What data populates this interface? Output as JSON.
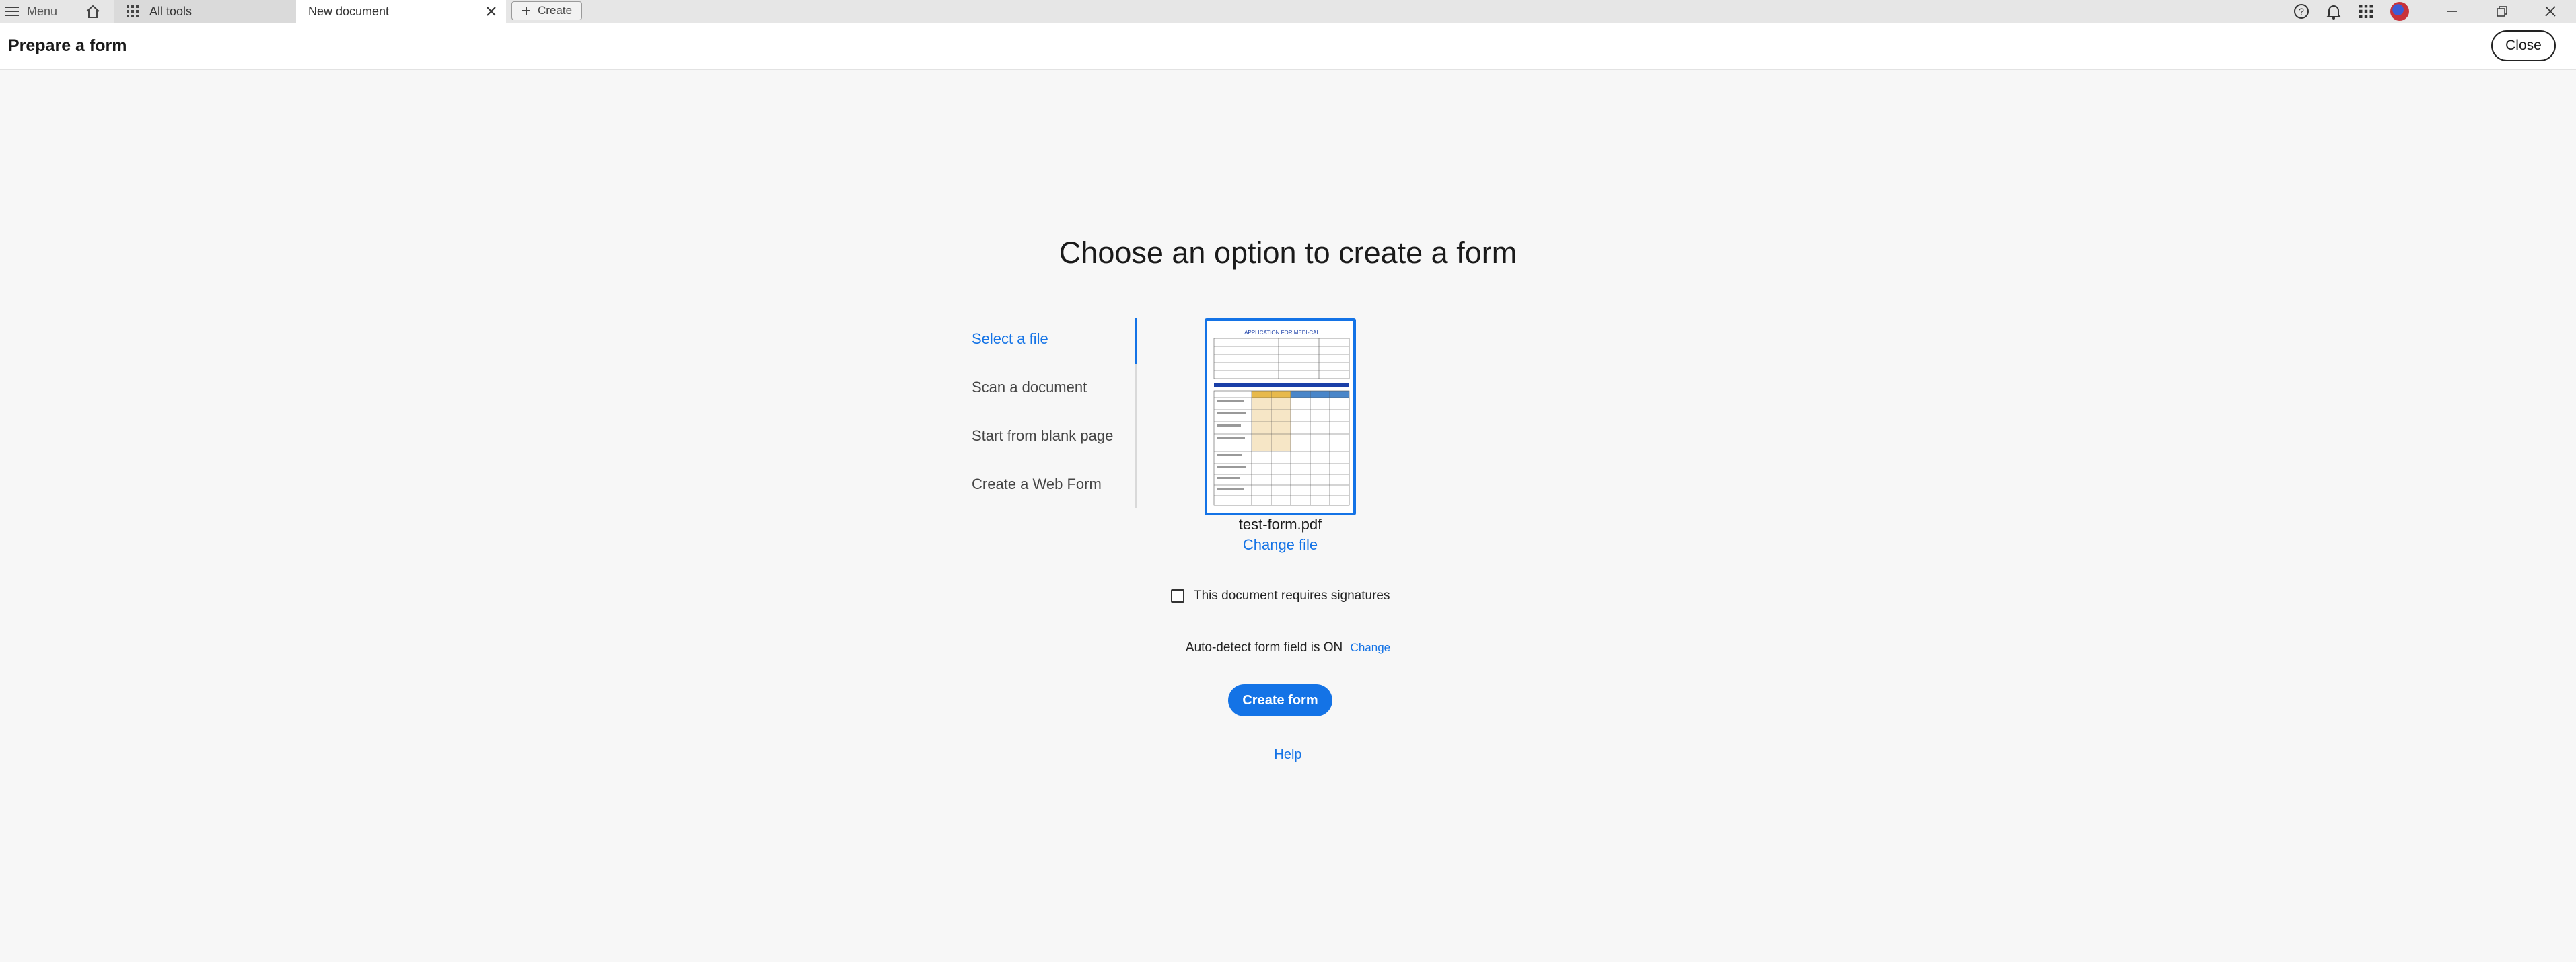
{
  "tabbar": {
    "menu_label": "Menu",
    "tabs": [
      {
        "label": "All tools",
        "icon": "grid-icon"
      },
      {
        "label": "New document",
        "icon": "close-icon"
      }
    ],
    "create_label": "Create",
    "right_icons": [
      "help-icon",
      "bell-icon",
      "apps-icon",
      "avatar",
      "minimize-icon",
      "restore-icon",
      "close-window-icon"
    ]
  },
  "header": {
    "title": "Prepare a form",
    "close_label": "Close"
  },
  "main": {
    "heading": "Choose an option to create a form",
    "options": [
      {
        "label": "Select a file",
        "active": true
      },
      {
        "label": "Scan a document",
        "active": false
      },
      {
        "label": "Start from blank page",
        "active": false
      },
      {
        "label": "Create a Web Form",
        "active": false
      }
    ],
    "thumbnail_title": "APPLICATION FOR MEDI-CAL",
    "file_name": "test-form.pdf",
    "change_file_label": "Change file",
    "signature_label": "This document requires signatures",
    "signature_checked": false,
    "auto_detect_text": "Auto-detect form field is ON",
    "auto_detect_change": "Change",
    "create_form_label": "Create form",
    "help_label": "Help"
  },
  "colors": {
    "accent": "#1473e6",
    "background": "#f7f7f7"
  }
}
